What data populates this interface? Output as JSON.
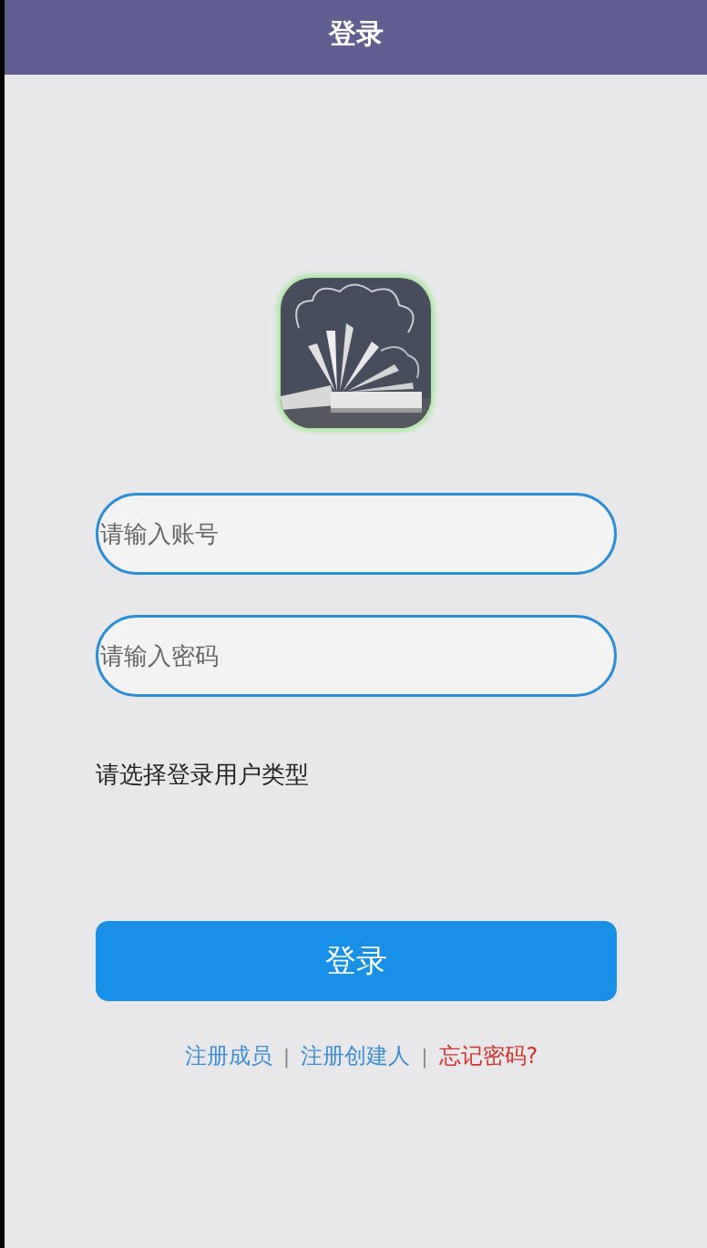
{
  "header": {
    "title": "登录"
  },
  "fields": [
    {
      "placeholder": "请输入账号"
    },
    {
      "placeholder": "请输入密码"
    }
  ],
  "user_type_label": "请选择登录用户类型",
  "login_button": "登录",
  "links": [
    {
      "text": "注册成员",
      "kind": "link",
      "color": "#3b8fd9"
    },
    {
      "text": "|",
      "kind": "separator"
    },
    {
      "text": "注册创建人",
      "kind": "link",
      "color": "#3b8fd9"
    },
    {
      "text": "|",
      "kind": "separator"
    },
    {
      "text": "忘记密码?",
      "kind": "link",
      "color": "#d8302a"
    }
  ]
}
